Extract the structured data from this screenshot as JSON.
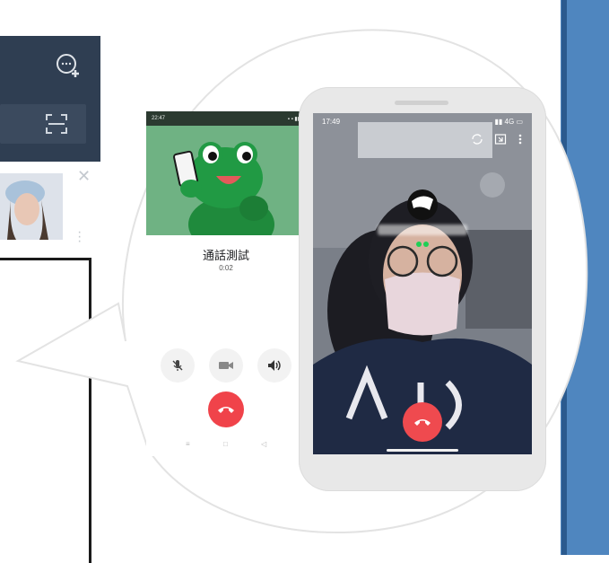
{
  "background_app": {
    "icons": [
      "add-chat-icon",
      "qr-scan-icon",
      "close-icon",
      "kebab-icon"
    ],
    "colors": {
      "header": "#2f3e52",
      "right_strip": "#4f86bf"
    }
  },
  "android_call": {
    "status_time": "22:47",
    "contact_name": "通話測試",
    "call_duration": "0:02",
    "controls": [
      "mute-mic-icon",
      "video-icon",
      "speaker-icon"
    ],
    "end_call_color": "#f0434a",
    "nav_icons": [
      "menu-icon",
      "home-icon",
      "back-icon"
    ]
  },
  "iphone_call": {
    "status_time": "17:49",
    "network": "4G",
    "header_icons": [
      "switch-camera-icon",
      "minimize-icon",
      "more-icon"
    ],
    "end_call_color": "#ef4a4f"
  }
}
